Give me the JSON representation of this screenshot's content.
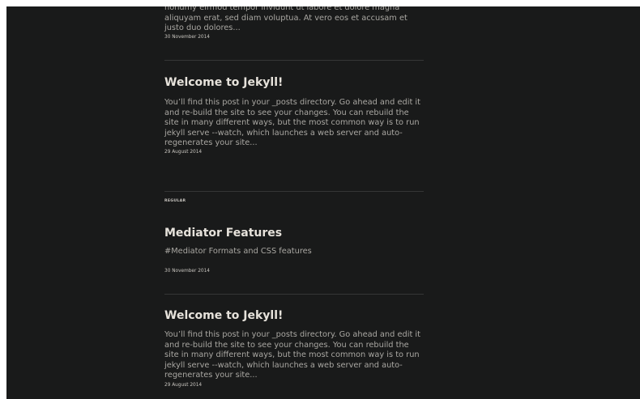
{
  "posts": [
    {
      "excerpt": "nonumy eirmod tempor invidunt ut labore et dolore magna aliquyam erat, sed diam voluptua. At vero eos et accusam et justo duo dolores...",
      "date": "30 November 2014"
    },
    {
      "title": "Welcome to Jekyll!",
      "excerpt": "You’ll find this post in your _posts directory. Go ahead and edit it and re-build the site to see your changes. You can rebuild the site in many different ways, but the most common way is to run jekyll serve --watch, which launches a web server and auto-regenerates your site...",
      "date": "29 August 2014"
    }
  ],
  "regular_section": {
    "label": "REGULAR",
    "posts": [
      {
        "title": "Mediator Features",
        "excerpt": "#Mediator Formats and CSS features",
        "date": "30 November 2014"
      },
      {
        "title": "Welcome to Jekyll!",
        "excerpt": "You’ll find this post in your _posts directory. Go ahead and edit it and re-build the site to see your changes. You can rebuild the site in many different ways, but the most common way is to run jekyll serve --watch, which launches a web server and auto-regenerates your site...",
        "date": "29 August 2014"
      }
    ]
  }
}
